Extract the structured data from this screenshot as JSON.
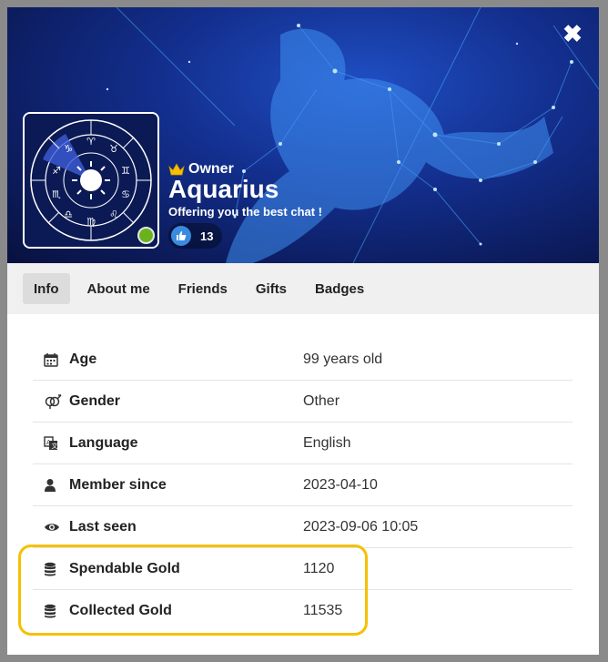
{
  "profile": {
    "rank": "Owner",
    "username": "Aquarius",
    "mood": "Offering you the best chat !",
    "likes": "13",
    "status_color": "#6ab21b"
  },
  "icons": {
    "close": "close-icon",
    "crown": "crown-icon",
    "like": "thumbs-up-icon"
  },
  "tabs": [
    {
      "label": "Info",
      "active": true
    },
    {
      "label": "About me",
      "active": false
    },
    {
      "label": "Friends",
      "active": false
    },
    {
      "label": "Gifts",
      "active": false
    },
    {
      "label": "Badges",
      "active": false
    }
  ],
  "info": [
    {
      "icon": "calendar-icon",
      "label": "Age",
      "value": "99 years old"
    },
    {
      "icon": "gender-icon",
      "label": "Gender",
      "value": "Other"
    },
    {
      "icon": "language-icon",
      "label": "Language",
      "value": "English"
    },
    {
      "icon": "user-icon",
      "label": "Member since",
      "value": "2023-04-10"
    },
    {
      "icon": "eye-icon",
      "label": "Last seen",
      "value": "2023-09-06 10:05"
    },
    {
      "icon": "coins-icon",
      "label": "Spendable Gold",
      "value": "1120"
    },
    {
      "icon": "coins-icon",
      "label": "Collected Gold",
      "value": "11535"
    }
  ],
  "colors": {
    "highlight": "#f6c000",
    "banner": "#132f8e"
  }
}
